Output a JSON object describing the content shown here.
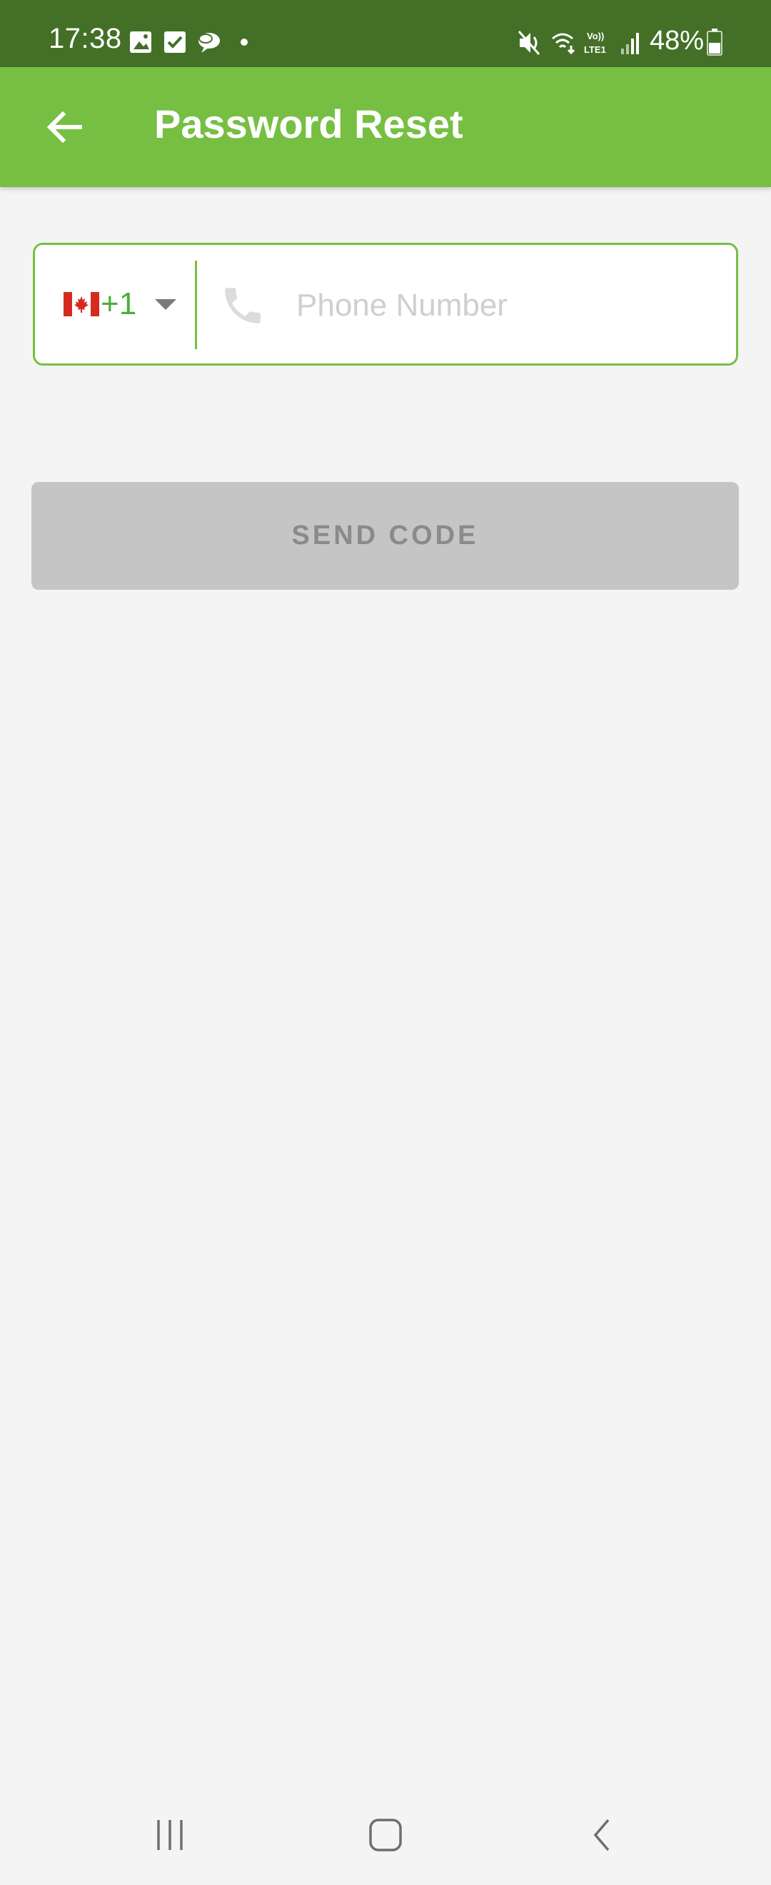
{
  "status_bar": {
    "time": "17:38",
    "battery": "48%",
    "icons_left": [
      "image-icon",
      "checkbox-icon",
      "chat-icon",
      "dot-icon"
    ],
    "icons_right": [
      "mute-icon",
      "wifi-icon",
      "volte-icon",
      "signal-icon",
      "battery-icon"
    ]
  },
  "app_bar": {
    "title": "Password Reset",
    "back_icon": "arrow-left-icon"
  },
  "phone_field": {
    "country_flag": "canada-flag-icon",
    "country_code": "+1",
    "placeholder": "Phone Number",
    "value": ""
  },
  "send_button": {
    "label": "SEND CODE"
  },
  "colors": {
    "status_bar": "#437026",
    "app_bar": "#76bf43",
    "accent": "#4caf3a",
    "background": "#f4f4f4",
    "button_disabled": "#c5c5c5",
    "button_text_disabled": "#8a8a8a"
  },
  "nav_bar": {
    "buttons": [
      "recent-apps-icon",
      "home-icon",
      "back-icon"
    ]
  }
}
